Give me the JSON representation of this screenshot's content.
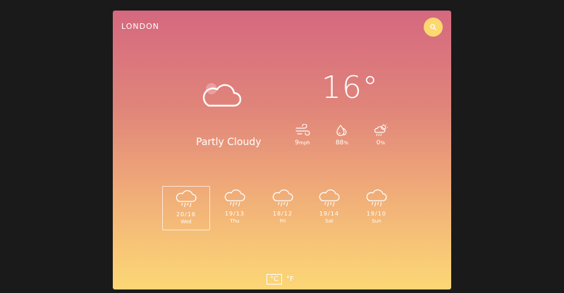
{
  "location": {
    "city": "LONDON"
  },
  "current": {
    "temperature": "16°",
    "condition": "Partly Cloudy",
    "icon": "partly-cloudy-icon"
  },
  "stats": [
    {
      "icon": "wind-icon",
      "value": "9",
      "unit": "mph"
    },
    {
      "icon": "humidity-icon",
      "value": "88",
      "unit": "%"
    },
    {
      "icon": "precipitation-icon",
      "value": "0",
      "unit": "%"
    }
  ],
  "forecast": [
    {
      "range": "20/16",
      "day": "Wed",
      "icon": "rain-icon",
      "selected": true
    },
    {
      "range": "19/13",
      "day": "Thu",
      "icon": "rain-icon",
      "selected": false
    },
    {
      "range": "18/12",
      "day": "Fri",
      "icon": "rain-icon",
      "selected": false
    },
    {
      "range": "19/14",
      "day": "Sat",
      "icon": "rain-icon",
      "selected": false
    },
    {
      "range": "19/10",
      "day": "Sun",
      "icon": "rain-icon",
      "selected": false
    }
  ],
  "units": {
    "celsius": "°C",
    "fahrenheit": "°F",
    "active": "celsius"
  },
  "colors": {
    "gradient_top": "#d5687f",
    "gradient_bottom": "#fcd775",
    "search_button": "#fdd86f",
    "text": "#ffffff"
  }
}
